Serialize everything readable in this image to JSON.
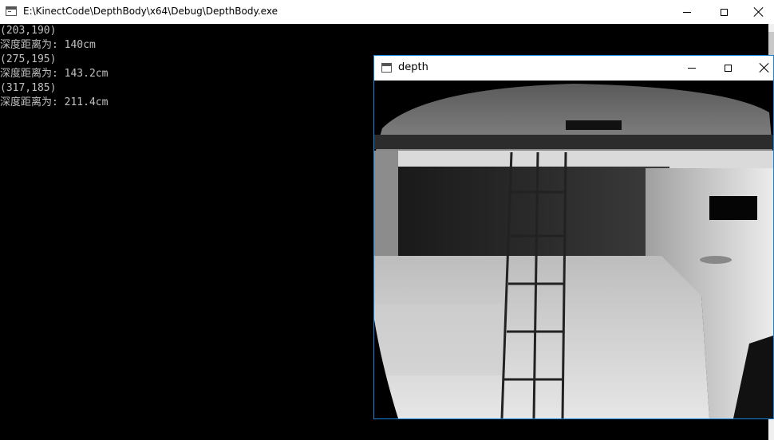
{
  "console": {
    "title": "E:\\KinectCode\\DepthBody\\x64\\Debug\\DepthBody.exe",
    "lines": [
      "(203,190)",
      "深度距离为: 140cm",
      "(275,195)",
      "深度距离为: 143.2cm",
      "(317,185)",
      "深度距离为: 211.4cm"
    ]
  },
  "depth_window": {
    "title": "depth"
  },
  "icons": {
    "app": "console-app-icon",
    "minimize": "minimize-icon",
    "maximize": "maximize-icon",
    "close": "close-icon"
  }
}
